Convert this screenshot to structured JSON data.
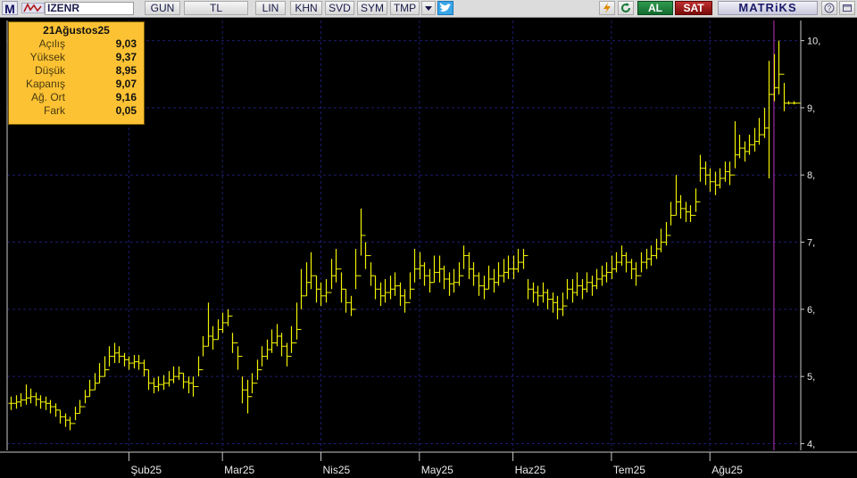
{
  "toolbar": {
    "logo": "M",
    "symbol": "IZENR",
    "period": "GUN",
    "currency": "TL",
    "scale": "LIN",
    "buttons": [
      "KHN",
      "SVD",
      "SYM",
      "TMP"
    ],
    "buy_label": "AL",
    "sell_label": "SAT",
    "brand": "MATRiKS",
    "colors": {
      "buy": "#1f8a3e",
      "sell": "#b01818",
      "brand": "#1a1a6a"
    },
    "icons": [
      "flag-icon",
      "dropdown-arrow-icon",
      "twitter-icon",
      "lightning-icon",
      "refresh-icon",
      "help-icon",
      "window-icon"
    ]
  },
  "infobox": {
    "date": "21Ağustos25",
    "rows": [
      {
        "label": "Açılış",
        "value": "9,03"
      },
      {
        "label": "Yüksek",
        "value": "9,37"
      },
      {
        "label": "Düşük",
        "value": "8,95"
      },
      {
        "label": "Kapanış",
        "value": "9,07"
      },
      {
        "label": "Ağ. Ort",
        "value": "9,16"
      },
      {
        "label": "Fark",
        "value": "0,05"
      }
    ]
  },
  "chart_data": {
    "type": "bar",
    "subtype": "ohlc",
    "symbol": "IZENR",
    "ylim": [
      3.9,
      10.3
    ],
    "yticks": [
      4,
      5,
      6,
      7,
      8,
      9,
      10
    ],
    "ytick_labels": [
      "4,",
      "5,",
      "6,",
      "7,",
      "8,",
      "9,",
      "10,"
    ],
    "month_labels": [
      "Şub25",
      "Mar25",
      "Nis25",
      "May25",
      "Haz25",
      "Tem25",
      "Ağu25"
    ],
    "month_positions": [
      24,
      43,
      63,
      83,
      102,
      122,
      142
    ],
    "cursor_index": 155,
    "last_value": 9.07,
    "colors": {
      "bar": "#f0f000",
      "grid": "#1c1c70",
      "axis": "#c8c8c8",
      "cursor": "#c030c0",
      "text": "#e8e8e8"
    },
    "values": [
      4.6,
      4.62,
      4.65,
      4.68,
      4.7,
      4.66,
      4.62,
      4.6,
      4.55,
      4.5,
      4.4,
      4.35,
      4.3,
      4.45,
      4.55,
      4.7,
      4.8,
      4.9,
      5.0,
      5.1,
      5.3,
      5.35,
      5.3,
      5.25,
      5.2,
      5.22,
      5.2,
      5.1,
      4.9,
      4.85,
      4.88,
      4.9,
      4.95,
      5.0,
      5.05,
      4.92,
      4.9,
      4.85,
      5.1,
      5.45,
      5.6,
      5.55,
      5.7,
      5.8,
      5.9,
      5.5,
      5.3,
      4.8,
      4.7,
      4.9,
      5.1,
      5.3,
      5.4,
      5.5,
      5.6,
      5.45,
      5.3,
      5.5,
      5.7,
      6.2,
      6.4,
      6.5,
      6.3,
      6.2,
      6.25,
      6.5,
      6.6,
      6.3,
      6.1,
      6.0,
      6.5,
      7.1,
      6.8,
      6.5,
      6.3,
      6.2,
      6.25,
      6.3,
      6.35,
      6.2,
      6.1,
      6.3,
      6.6,
      6.65,
      6.5,
      6.4,
      6.55,
      6.6,
      6.45,
      6.38,
      6.4,
      6.5,
      6.8,
      6.6,
      6.5,
      6.35,
      6.3,
      6.45,
      6.4,
      6.5,
      6.55,
      6.6,
      6.6,
      6.7,
      6.8,
      6.3,
      6.25,
      6.2,
      6.25,
      6.15,
      6.1,
      6.0,
      6.05,
      6.3,
      6.25,
      6.35,
      6.3,
      6.4,
      6.35,
      6.45,
      6.5,
      6.55,
      6.6,
      6.7,
      6.8,
      6.7,
      6.6,
      6.5,
      6.7,
      6.75,
      6.8,
      6.9,
      7.0,
      7.1,
      7.4,
      7.6,
      7.5,
      7.45,
      7.4,
      7.6,
      8.1,
      8.0,
      7.9,
      7.85,
      7.95,
      8.05,
      8.0,
      8.3,
      8.4,
      8.35,
      8.45,
      8.5,
      8.6,
      8.7,
      9.2,
      9.3,
      9.5,
      9.07,
      9.07,
      9.07
    ],
    "highs": [
      4.7,
      4.72,
      4.75,
      4.88,
      4.82,
      4.76,
      4.72,
      4.7,
      4.65,
      4.6,
      4.5,
      4.45,
      4.4,
      4.55,
      4.65,
      4.8,
      4.95,
      5.05,
      5.2,
      5.3,
      5.45,
      5.5,
      5.45,
      5.35,
      5.3,
      5.32,
      5.32,
      5.25,
      5.1,
      4.98,
      5.0,
      5.02,
      5.08,
      5.15,
      5.15,
      5.05,
      5.0,
      5.0,
      5.3,
      5.6,
      6.1,
      5.75,
      5.85,
      5.95,
      6.0,
      5.65,
      5.45,
      5.0,
      4.95,
      5.05,
      5.25,
      5.45,
      5.55,
      5.7,
      5.78,
      5.65,
      5.5,
      5.75,
      6.1,
      6.6,
      6.7,
      6.85,
      6.5,
      6.4,
      6.45,
      6.75,
      6.9,
      6.55,
      6.3,
      6.2,
      6.9,
      7.5,
      7.0,
      6.7,
      6.5,
      6.4,
      6.45,
      6.5,
      6.55,
      6.4,
      6.3,
      6.55,
      6.9,
      6.85,
      6.7,
      6.6,
      6.8,
      6.8,
      6.65,
      6.55,
      6.6,
      6.7,
      6.95,
      6.85,
      6.7,
      6.55,
      6.5,
      6.65,
      6.6,
      6.7,
      6.75,
      6.8,
      6.8,
      6.9,
      6.9,
      6.45,
      6.4,
      6.35,
      6.4,
      6.3,
      6.25,
      6.2,
      6.25,
      6.45,
      6.45,
      6.55,
      6.45,
      6.55,
      6.5,
      6.6,
      6.65,
      6.7,
      6.8,
      6.85,
      6.95,
      6.85,
      6.75,
      6.7,
      6.85,
      6.9,
      6.95,
      7.05,
      7.2,
      7.3,
      7.6,
      8.0,
      7.7,
      7.6,
      7.55,
      7.8,
      8.3,
      8.2,
      8.1,
      8.05,
      8.1,
      8.2,
      8.2,
      8.8,
      8.6,
      8.5,
      8.6,
      8.7,
      8.85,
      9.0,
      9.7,
      9.8,
      10.0,
      9.37,
      9.1,
      9.1
    ],
    "lows": [
      4.5,
      4.52,
      4.55,
      4.58,
      4.6,
      4.56,
      4.52,
      4.5,
      4.45,
      4.4,
      4.3,
      4.25,
      4.2,
      4.35,
      4.45,
      4.6,
      4.7,
      4.8,
      4.9,
      5.0,
      5.15,
      5.2,
      5.2,
      5.15,
      5.1,
      5.12,
      5.1,
      5.0,
      4.8,
      4.75,
      4.78,
      4.8,
      4.85,
      4.9,
      4.95,
      4.82,
      4.75,
      4.7,
      5.0,
      5.3,
      5.45,
      5.4,
      5.55,
      5.65,
      5.75,
      5.35,
      5.1,
      4.6,
      4.45,
      4.75,
      4.95,
      5.15,
      5.25,
      5.35,
      5.45,
      5.3,
      5.15,
      5.35,
      5.55,
      6.0,
      6.2,
      6.3,
      6.1,
      6.05,
      6.1,
      6.3,
      6.4,
      6.1,
      5.95,
      5.9,
      6.3,
      6.8,
      6.6,
      6.35,
      6.15,
      6.05,
      6.1,
      6.15,
      6.2,
      6.05,
      5.95,
      6.15,
      6.4,
      6.45,
      6.35,
      6.25,
      6.4,
      6.4,
      6.3,
      6.2,
      6.25,
      6.35,
      6.6,
      6.45,
      6.35,
      6.2,
      6.15,
      6.3,
      6.25,
      6.35,
      6.4,
      6.45,
      6.45,
      6.55,
      6.6,
      6.15,
      6.1,
      6.05,
      6.1,
      6.0,
      5.95,
      5.85,
      5.9,
      6.15,
      6.1,
      6.2,
      6.15,
      6.25,
      6.2,
      6.3,
      6.35,
      6.4,
      6.45,
      6.55,
      6.65,
      6.55,
      6.45,
      6.35,
      6.55,
      6.6,
      6.65,
      6.75,
      6.85,
      6.95,
      7.25,
      7.4,
      7.35,
      7.3,
      7.3,
      7.45,
      7.9,
      7.85,
      7.75,
      7.7,
      7.8,
      7.9,
      7.85,
      8.1,
      8.25,
      8.2,
      8.3,
      8.35,
      8.45,
      8.55,
      7.95,
      9.1,
      9.2,
      8.95,
      9.05,
      9.05
    ]
  }
}
